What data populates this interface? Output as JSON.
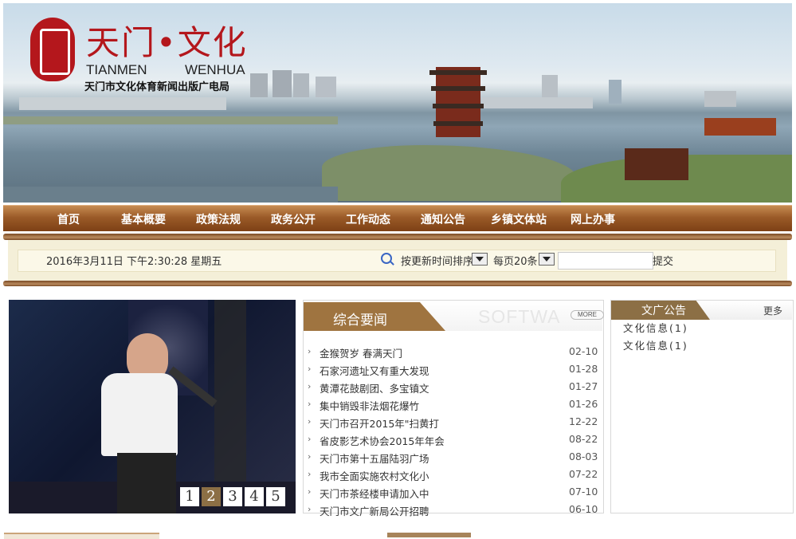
{
  "header": {
    "title_cn": "天门•文化",
    "title_en_1": "TIANMEN",
    "title_en_2": "WENHUA",
    "org": "天门市文化体育新闻出版广电局",
    "logo_icon": "seal-logo-icon"
  },
  "nav": {
    "items": [
      {
        "label": "首页"
      },
      {
        "label": "基本概要"
      },
      {
        "label": "政策法规"
      },
      {
        "label": "政务公开"
      },
      {
        "label": "工作动态"
      },
      {
        "label": "通知公告"
      },
      {
        "label": "乡镇文体站"
      },
      {
        "label": "网上办事"
      }
    ]
  },
  "toolbar": {
    "datetime": "2016年3月11日 下午2:30:28 星期五",
    "sort_label": "按更新时间排序",
    "per_page_label": "每页20条",
    "search_value": "",
    "submit_label": "提交"
  },
  "slideshow": {
    "pages": [
      "1",
      "2",
      "3",
      "4",
      "5"
    ],
    "active_page": "2"
  },
  "news": {
    "title": "综合要闻",
    "watermark": "SOFTWA",
    "more_label": "MORE",
    "items": [
      {
        "title": "金猴贺岁 春满天门",
        "date": "02-10"
      },
      {
        "title": "石家河遗址又有重大发现",
        "date": "01-28"
      },
      {
        "title": "黄潭花鼓剧团、多宝镇文",
        "date": "01-27"
      },
      {
        "title": "集中销毁非法烟花爆竹",
        "date": "01-26"
      },
      {
        "title": "天门市召开2015年\"扫黄打",
        "date": "12-22"
      },
      {
        "title": "省皮影艺术协会2015年年会",
        "date": "08-22"
      },
      {
        "title": "天门市第十五届陆羽广场",
        "date": "08-03"
      },
      {
        "title": "我市全面实施农村文化小",
        "date": "07-22"
      },
      {
        "title": "天门市茶经楼申请加入中",
        "date": "07-10"
      },
      {
        "title": "天门市文广新局公开招聘",
        "date": "06-10"
      }
    ]
  },
  "notice": {
    "title": "文广公告",
    "more_label": "更多",
    "items": [
      {
        "label": "文化信息(1)"
      },
      {
        "label": "文化信息(1)"
      }
    ]
  },
  "colors": {
    "brand_red": "#b4171c",
    "nav_brown": "#9b5b28",
    "tab_brown": "#9f7440",
    "active_page": "#8c6f45"
  }
}
